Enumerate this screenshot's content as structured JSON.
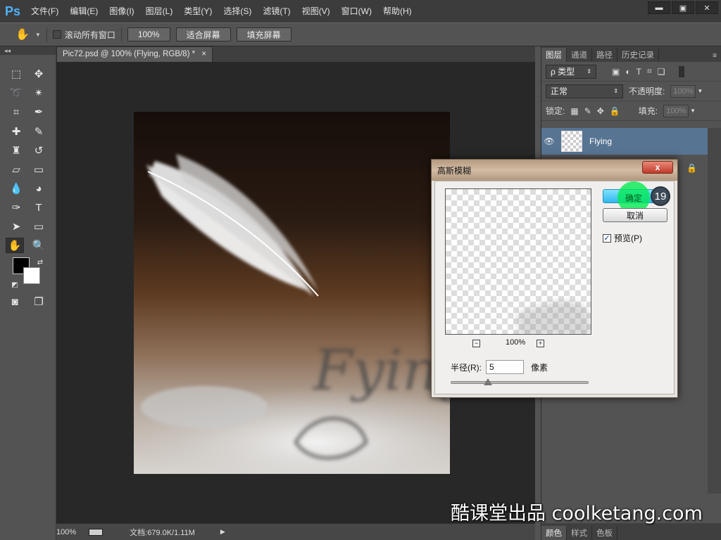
{
  "app": {
    "logo": "Ps"
  },
  "menu": [
    "文件(F)",
    "编辑(E)",
    "图像(I)",
    "图层(L)",
    "类型(Y)",
    "选择(S)",
    "滤镜(T)",
    "视图(V)",
    "窗口(W)",
    "帮助(H)"
  ],
  "window_controls": {
    "minimize": "▬",
    "maximize": "▣",
    "close": "✕"
  },
  "options_bar": {
    "scroll_all_windows": "滚动所有窗口",
    "zoom_100": "100%",
    "fit_screen": "适合屏幕",
    "fill_screen": "填充屏幕"
  },
  "document": {
    "tab_title": "Pic72.psd @ 100% (Flying, RGB/8) *",
    "tab_close": "×",
    "photo_text": "Fying"
  },
  "status_bar": {
    "zoom": "100%",
    "doc_info": "文档:679.0K/1.11M"
  },
  "panels": {
    "tabs": [
      "图层",
      "通道",
      "路径",
      "历史记录"
    ],
    "filter_label": "ρ 类型",
    "blend_mode": "正常",
    "opacity_label": "不透明度:",
    "opacity_value": "100%",
    "lock_label": "锁定:",
    "fill_label": "填充:",
    "fill_value": "100%",
    "layer_name": "Flying",
    "bottom_tabs": [
      "颜色",
      "样式",
      "色板"
    ]
  },
  "dialog": {
    "title": "高斯模糊",
    "close": "x",
    "ok": "确定",
    "cancel": "取消",
    "preview_label": "预览(P)",
    "preview_checked": true,
    "zoom_out": "−",
    "zoom_in": "+",
    "zoom": "100%",
    "radius_label": "半径(R):",
    "radius_value": "5",
    "unit": "像素",
    "slider_fraction": 0.27
  },
  "step_badge": "19",
  "watermark": "酷课堂出品 coolketang.com",
  "colors": {
    "accent": "#31b5ec",
    "highlight": "#00eb50",
    "layer_selected": "#587493",
    "foreground": "#000000",
    "background": "#ffffff"
  }
}
